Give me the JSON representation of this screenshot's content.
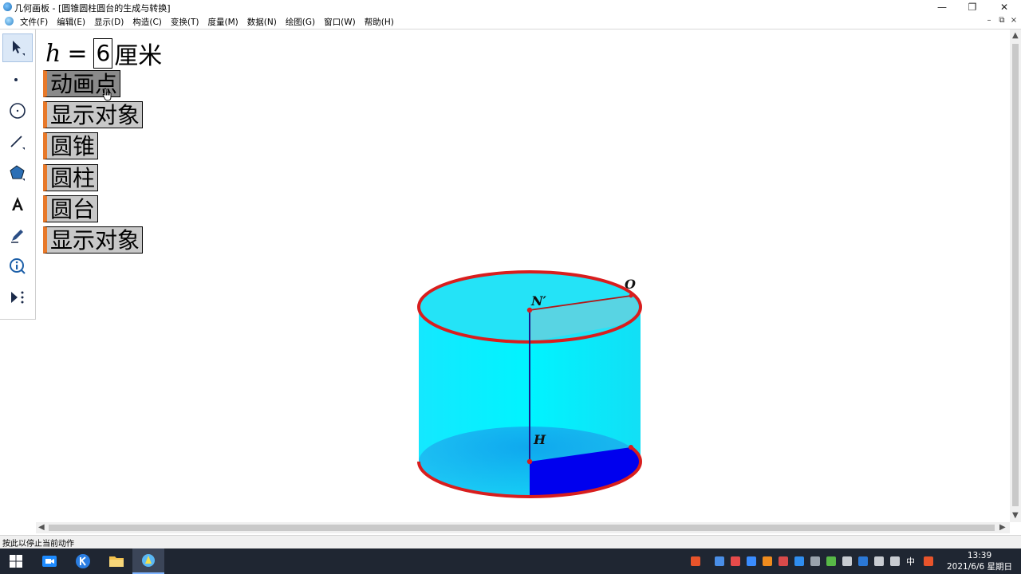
{
  "window": {
    "title": "几何画板 - [圆锥圆柱圆台的生成与转换]",
    "minimize_glyph": "—",
    "maximize_glyph": "❐",
    "close_glyph": "✕",
    "mdi_minimize_glyph": "–",
    "mdi_restore_glyph": "⧉",
    "mdi_close_glyph": "×"
  },
  "menu": {
    "items": [
      "文件(F)",
      "编辑(E)",
      "显示(D)",
      "构造(C)",
      "变换(T)",
      "度量(M)",
      "数据(N)",
      "绘图(G)",
      "窗口(W)",
      "帮助(H)"
    ]
  },
  "toolbox": {
    "tools": [
      "arrow-select",
      "point",
      "compass",
      "straightedge",
      "polygon",
      "text",
      "marker",
      "information",
      "custom"
    ]
  },
  "parameter": {
    "variable": "h",
    "equals": "=",
    "value": "6",
    "unit": "厘米"
  },
  "buttons": {
    "animate": "动画点",
    "show_objects_1": "显示对象",
    "cone": "圆锥",
    "cylinder": "圆柱",
    "frustum": "圆台",
    "show_objects_2": "显示对象"
  },
  "figure": {
    "label_top_center": "N′",
    "label_edge": "O",
    "label_bottom_center": "H",
    "colors": {
      "surface": "#00f0ff",
      "rim": "#d81e1e",
      "sector": "#0000ee",
      "axis": "#1a1a8c"
    }
  },
  "statusbar": {
    "text": "按此以停止当前动作"
  },
  "taskbar": {
    "time": "13:39",
    "date": "2021/6/6 星期日",
    "ime": "中"
  }
}
